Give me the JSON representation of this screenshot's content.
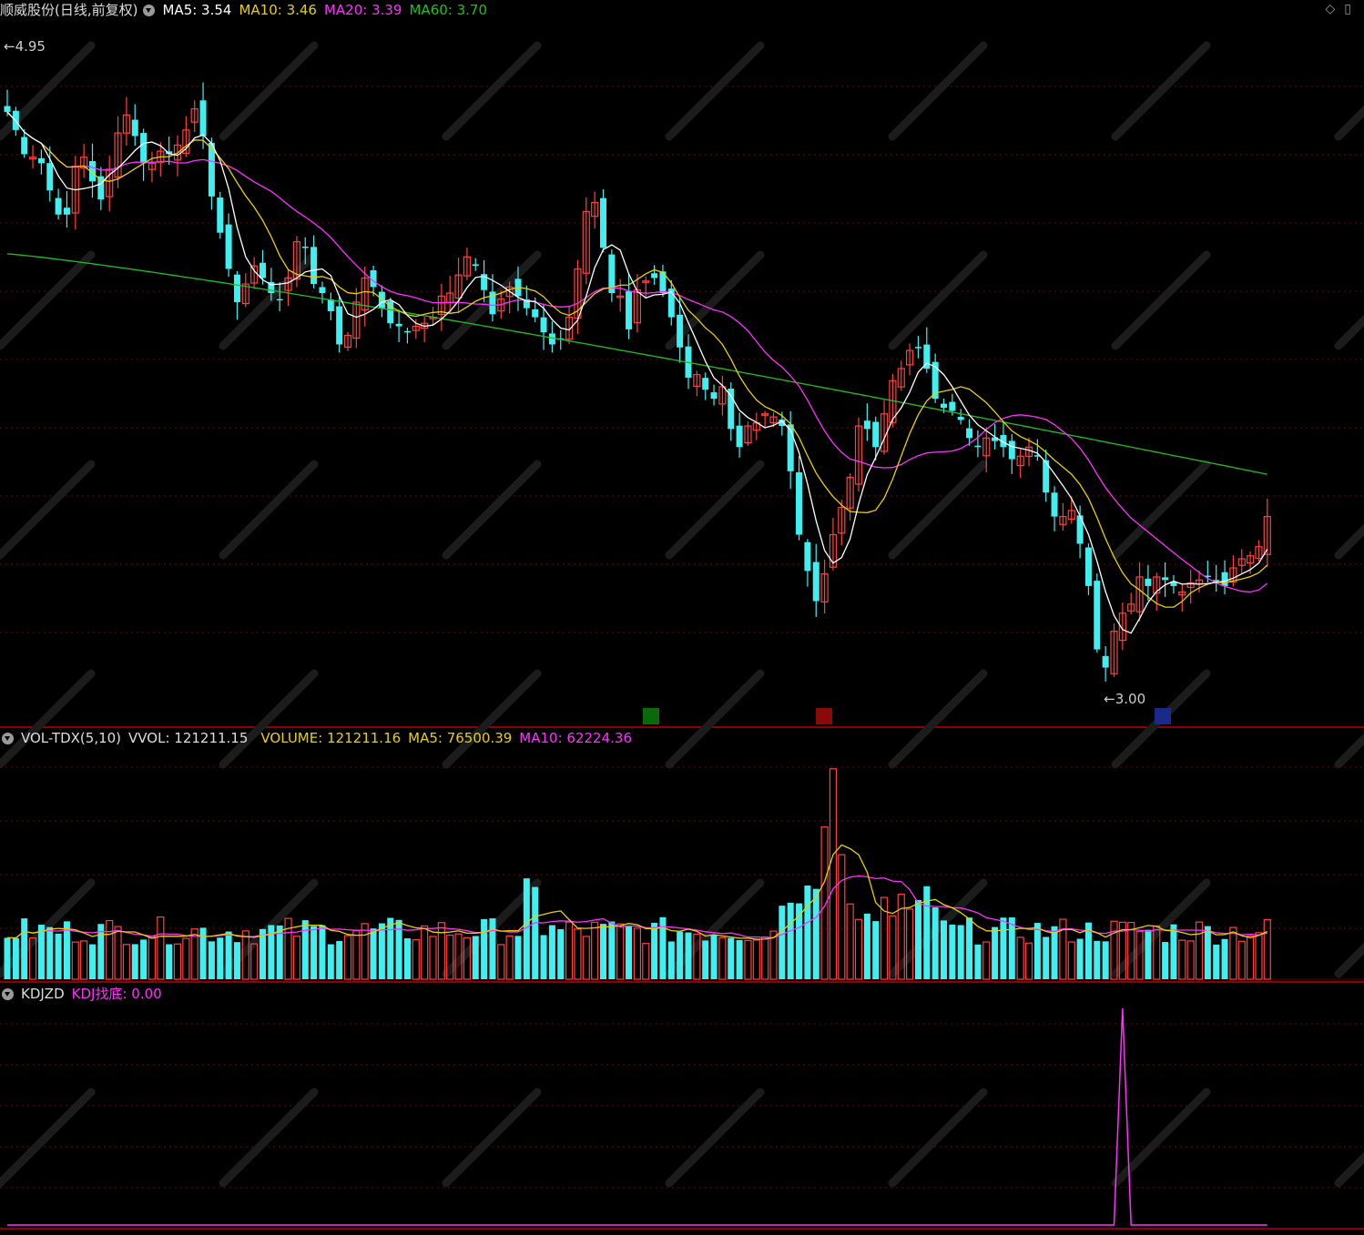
{
  "main_header": {
    "title": "顺威股份(日线,前复权)",
    "ma5": "MA5: 3.54",
    "ma10": "MA10: 3.46",
    "ma20": "MA20: 3.39",
    "ma60": "MA60: 3.70"
  },
  "vol_header": {
    "name": "VOL-TDX(5,10)",
    "vvol": "VVOL: 121211.15",
    "volume": "VOLUME: 121211.16",
    "ma5": "MA5: 76500.39",
    "ma10": "MA10: 62224.36"
  },
  "kdj_header": {
    "name": "KDJZD",
    "value": "KDJ找底: 0.00"
  },
  "colors": {
    "up": "#ff4040",
    "down": "#40f0f0",
    "ma5": "#ffffff",
    "ma10": "#e8d000",
    "ma20": "#ff30ff",
    "ma60": "#20c020",
    "grid": "#7a0000",
    "panel_border": "#c00000"
  },
  "chart_data": [
    {
      "type": "candlestick",
      "name": "price",
      "ylim": [
        2.95,
        5.15
      ],
      "high_label": "4.95",
      "low_label": "3.00",
      "overlays": [
        "MA5",
        "MA10",
        "MA20",
        "MA60"
      ],
      "closes": [
        4.9,
        4.84,
        4.76,
        4.75,
        4.73,
        4.64,
        4.56,
        4.56,
        4.72,
        4.75,
        4.67,
        4.61,
        4.71,
        4.83,
        4.89,
        4.82,
        4.73,
        4.73,
        4.77,
        4.76,
        4.79,
        4.84,
        4.91,
        4.82,
        4.62,
        4.5,
        4.38,
        4.27,
        4.33,
        4.39,
        4.35,
        4.3,
        4.28,
        4.35,
        4.47,
        4.45,
        4.33,
        4.3,
        4.24,
        4.13,
        4.16,
        4.27,
        4.35,
        4.32,
        4.25,
        4.2,
        4.19,
        4.17,
        4.19,
        4.2,
        4.22,
        4.29,
        4.3,
        4.36,
        4.42,
        4.39,
        4.31,
        4.23,
        4.28,
        4.32,
        4.29,
        4.25,
        4.22,
        4.17,
        4.13,
        4.15,
        4.22,
        4.38,
        4.57,
        4.6,
        4.45,
        4.3,
        4.29,
        4.18,
        4.31,
        4.34,
        4.35,
        4.3,
        4.22,
        4.12,
        4.02,
        4.03,
        3.98,
        3.95,
        3.99,
        3.85,
        3.79,
        3.86,
        3.87,
        3.9,
        3.89,
        3.86,
        3.71,
        3.5,
        3.38,
        3.28,
        3.37,
        3.5,
        3.59,
        3.69,
        3.86,
        3.85,
        3.79,
        3.9,
        4.01,
        4.05,
        4.11,
        4.12,
        4.05,
        3.95,
        3.92,
        3.91,
        3.88,
        3.82,
        3.79,
        3.82,
        3.81,
        3.79,
        3.75,
        3.76,
        3.79,
        3.76,
        3.64,
        3.56,
        3.56,
        3.58,
        3.47,
        3.33,
        3.12,
        3.06,
        3.18,
        3.24,
        3.27,
        3.36,
        3.33,
        3.36,
        3.35,
        3.33,
        3.31,
        3.34,
        3.35,
        3.36,
        3.35,
        3.33,
        3.39,
        3.42,
        3.43,
        3.46,
        3.56
      ],
      "ma60_start": 4.43,
      "ma60_end": 3.7
    },
    {
      "type": "bar",
      "name": "volume",
      "ylim": [
        0,
        165000
      ],
      "overlays": [
        "MA5",
        "MA10"
      ],
      "bars": 156
    },
    {
      "type": "line",
      "name": "KDJ找底",
      "ylim": [
        0,
        1
      ],
      "spike_at_bar": 131,
      "spike_value": 1
    }
  ]
}
